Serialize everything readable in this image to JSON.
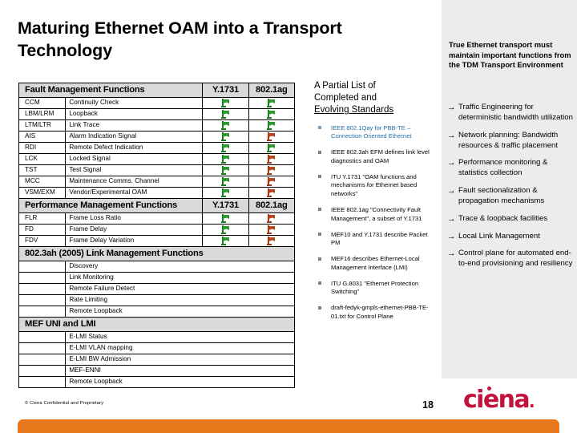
{
  "slide": {
    "title": "Maturing Ethernet OAM into a Transport Technology",
    "page_number": "18",
    "footer_note": "© Ciena Confidential and Proprietary",
    "logo_text": "ciena",
    "logo_dot": ".",
    "accent_orange": "#e8761a",
    "logo_color": "#c4123f",
    "panel_gray": "#ececec"
  },
  "table": {
    "columns": [
      "Fault Management Functions",
      "Y.1731",
      "802.1ag"
    ],
    "sections": [
      {
        "header": {
          "label": "Fault Management Functions",
          "col_y": "Y.1731",
          "col_a": "802.1ag"
        },
        "rows": [
          {
            "code": "CCM",
            "desc": "Continuity Check",
            "y": "green",
            "a": "green"
          },
          {
            "code": "LBM/LRM",
            "desc": "Loopback",
            "y": "green",
            "a": "green"
          },
          {
            "code": "LTM/LTR",
            "desc": "Link Trace",
            "y": "green",
            "a": "green"
          },
          {
            "code": "AIS",
            "desc": "Alarm Indication Signal",
            "y": "green",
            "a": "red"
          },
          {
            "code": "RDI",
            "desc": "Remote Defect Indication",
            "y": "green",
            "a": "green"
          },
          {
            "code": "LCK",
            "desc": "Locked Signal",
            "y": "green",
            "a": "red"
          },
          {
            "code": "TST",
            "desc": "Test Signal",
            "y": "green",
            "a": "red"
          },
          {
            "code": "MCC",
            "desc": "Maintenance Comms. Channel",
            "y": "green",
            "a": "red"
          },
          {
            "code": "VSM/EXM",
            "desc": "Vendor/Experimental OAM",
            "y": "green",
            "a": "red"
          }
        ]
      },
      {
        "header": {
          "label": "Performance Management Functions",
          "col_y": "Y.1731",
          "col_a": "802.1ag"
        },
        "rows": [
          {
            "code": "FLR",
            "desc": "Frame Loss Ratio",
            "y": "green",
            "a": "red"
          },
          {
            "code": "FD",
            "desc": "Frame Delay",
            "y": "green",
            "a": "red"
          },
          {
            "code": "FDV",
            "desc": "Frame Delay Variation",
            "y": "green",
            "a": "red"
          }
        ]
      },
      {
        "header": {
          "label": "802.3ah (2005) Link Management Functions"
        },
        "rows": [
          {
            "desc": "Discovery"
          },
          {
            "desc": "Link Monitoring"
          },
          {
            "desc": "Remote Failure Detect"
          },
          {
            "desc": "Rate Limiting"
          },
          {
            "desc": "Remote Loopback"
          }
        ]
      },
      {
        "header": {
          "label": "MEF UNI and LMI"
        },
        "rows": [
          {
            "desc": "E-LMI Status"
          },
          {
            "desc": "E-LMI VLAN mapping"
          },
          {
            "desc": "E-LMI BW Admission"
          },
          {
            "desc": "MEF-ENNI"
          },
          {
            "desc": "Remote Loopback"
          }
        ]
      }
    ]
  },
  "standards": {
    "title_line1": "A Partial List of",
    "title_line2": "Completed and",
    "title_line3": "Evolving Standards",
    "items": [
      {
        "text": "IEEE 802.1Qay for PBB-TE – Connection Oriented Ethernet",
        "style": "link"
      },
      {
        "text": "IEEE 802.3ah EFM defines link level diagnostics and OAM",
        "style": "plain"
      },
      {
        "text": "ITU Y.1731 \"OAM functions and mechanisms for Ethernet based networks\"",
        "style": "plain"
      },
      {
        "text": "IEEE 802.1ag \"Connectivity Fault Management\", a subset of Y.1731",
        "style": "plain"
      },
      {
        "text": "MEF10 and Y.1731 describe Packet PM",
        "style": "plain"
      },
      {
        "text": "MEF16 describes Ethernet-Local Management Interface (LMI)",
        "style": "plain"
      },
      {
        "text": "ITU G.8031 \"Ethernet Protection Switching\"",
        "style": "plain"
      },
      {
        "text": "draft-fedyk-gmpls-ethernet-PBB-TE-01.txt for Control Plane",
        "style": "plain"
      }
    ]
  },
  "requirements": {
    "heading": "True Ethernet transport must maintain important functions from the TDM Transport Environment",
    "arrow_glyph": "→",
    "items": [
      "Traffic Engineering for deterministic bandwidth utilization",
      "Network planning: Bandwidth resources & traffic placement",
      "Performance monitoring & statistics collection",
      "Fault sectionalization & propagation mechanisms",
      "Trace & loopback facilities",
      "Local Link Management",
      "Control plane for automated end-to-end provisioning and resiliency"
    ]
  }
}
